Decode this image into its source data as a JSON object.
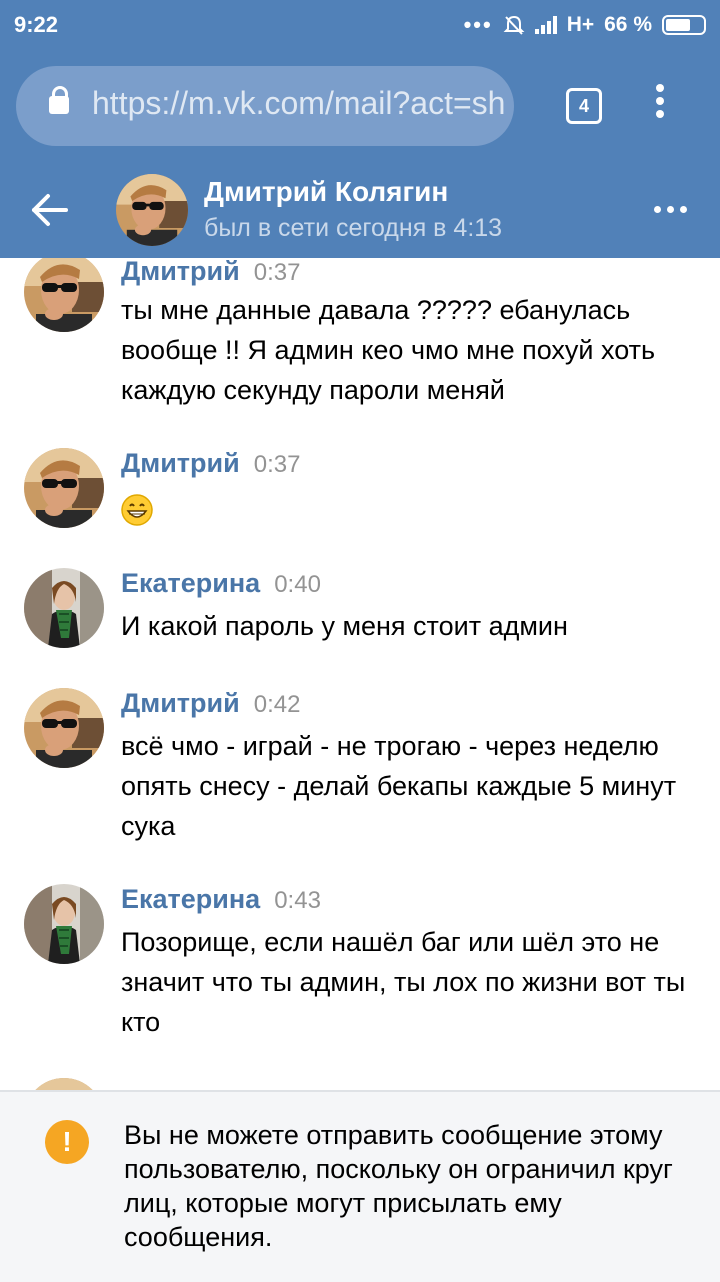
{
  "status_bar": {
    "time": "9:22",
    "network": "H+",
    "battery": "66 %"
  },
  "browser": {
    "url": "https://m.vk.com/mail?act=sh",
    "tab_count": "4",
    "icons": [
      "lock-icon",
      "tabs-icon",
      "menu-icon"
    ]
  },
  "chat_header": {
    "name": "Дмитрий Колягин",
    "status": "был в сети сегодня в 4:13",
    "icons": [
      "back-arrow-icon",
      "more-icon"
    ]
  },
  "messages": [
    {
      "author": "Дмитрий",
      "time": "0:37",
      "text": "ты мне данные давала ????? ебанулась вообще !! Я админ кео чмо мне похуй хоть каждую секунду пароли меняй"
    },
    {
      "author": "Дмитрий",
      "time": "0:37",
      "text": "",
      "emoji": "grinning-face-emoji"
    },
    {
      "author": "Екатерина",
      "time": "0:40",
      "text": "И какой пароль у меня стоит админ"
    },
    {
      "author": "Дмитрий",
      "time": "0:42",
      "text": "всё чмо - играй - не трогаю - через неделю опять снесу - делай бекапы каждые 5 минут сука"
    },
    {
      "author": "Екатерина",
      "time": "0:43",
      "text": "Позорище, если нашёл баг или шёл это не значит что ты админ, ты лох по жизни вот ты кто"
    }
  ],
  "notice": {
    "text": "Вы не можете отправить сообщение этому пользователю, поскольку он ограничил круг лиц, которые могут присылать ему сообщения.",
    "icon": "warning-icon"
  },
  "colors": {
    "header_bg": "#5181b8",
    "author_name": "#4a76a8",
    "warning": "#f5a623"
  }
}
